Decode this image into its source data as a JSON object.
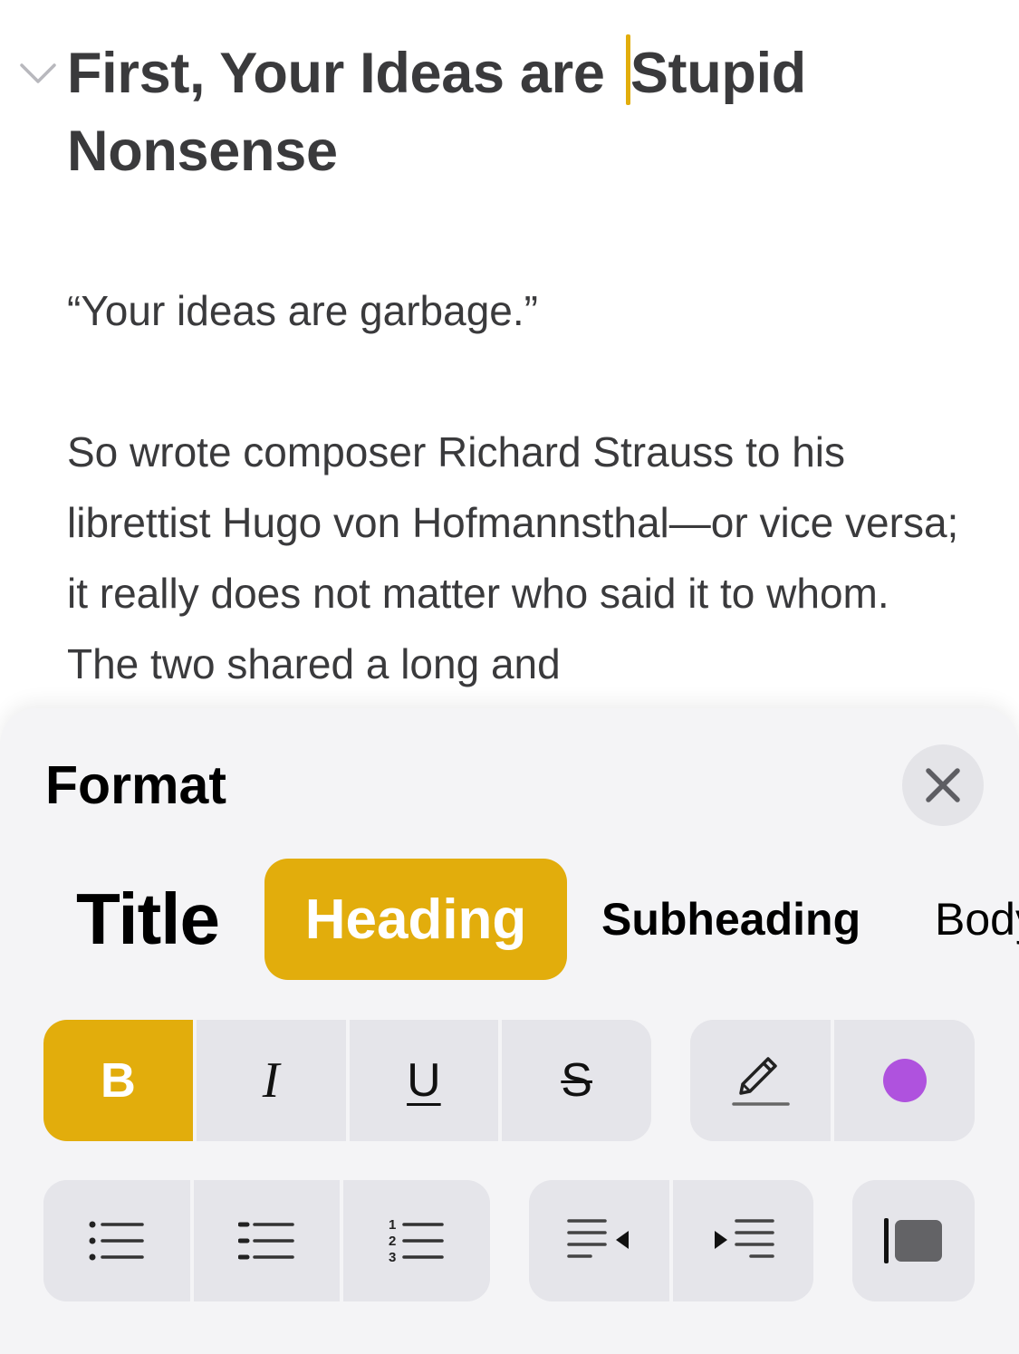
{
  "note": {
    "heading": "First, Your Ideas are Stupid Nonsense",
    "heading_part1": "First, Your Ideas are",
    "heading_part2": "Stupid Nonsense",
    "quote": "“Your ideas are garbage.”",
    "body": "So wrote composer Richard Strauss to his librettist Hugo von Hofmannsthal—or vice versa; it really does not matter who said it to whom. The two shared a long and"
  },
  "format_panel": {
    "title": "Format",
    "close_icon": "xmark-icon",
    "styles": [
      {
        "label": "Title",
        "selected": false
      },
      {
        "label": "Heading",
        "selected": true
      },
      {
        "label": "Subheading",
        "selected": false
      },
      {
        "label": "Body",
        "selected": false
      }
    ],
    "text_styles": {
      "bold": {
        "label": "B",
        "active": true
      },
      "italic": {
        "label": "I",
        "active": false
      },
      "underline": {
        "label": "U",
        "active": false
      },
      "strikethrough": {
        "label": "S",
        "active": false
      }
    },
    "highlight_icon": "pencil-highlight-icon",
    "text_color": "#af52de",
    "list_icons": [
      "bulleted-list-icon",
      "dashed-list-icon",
      "numbered-list-icon"
    ],
    "indent_icons": [
      "decrease-indent-icon",
      "increase-indent-icon"
    ],
    "blockquote_icon": "block-quote-icon"
  },
  "colors": {
    "accent": "#e2ad0c",
    "text": "#3a3a3c",
    "panel_bg": "#f4f4f6",
    "button_bg": "#e5e5ea"
  }
}
